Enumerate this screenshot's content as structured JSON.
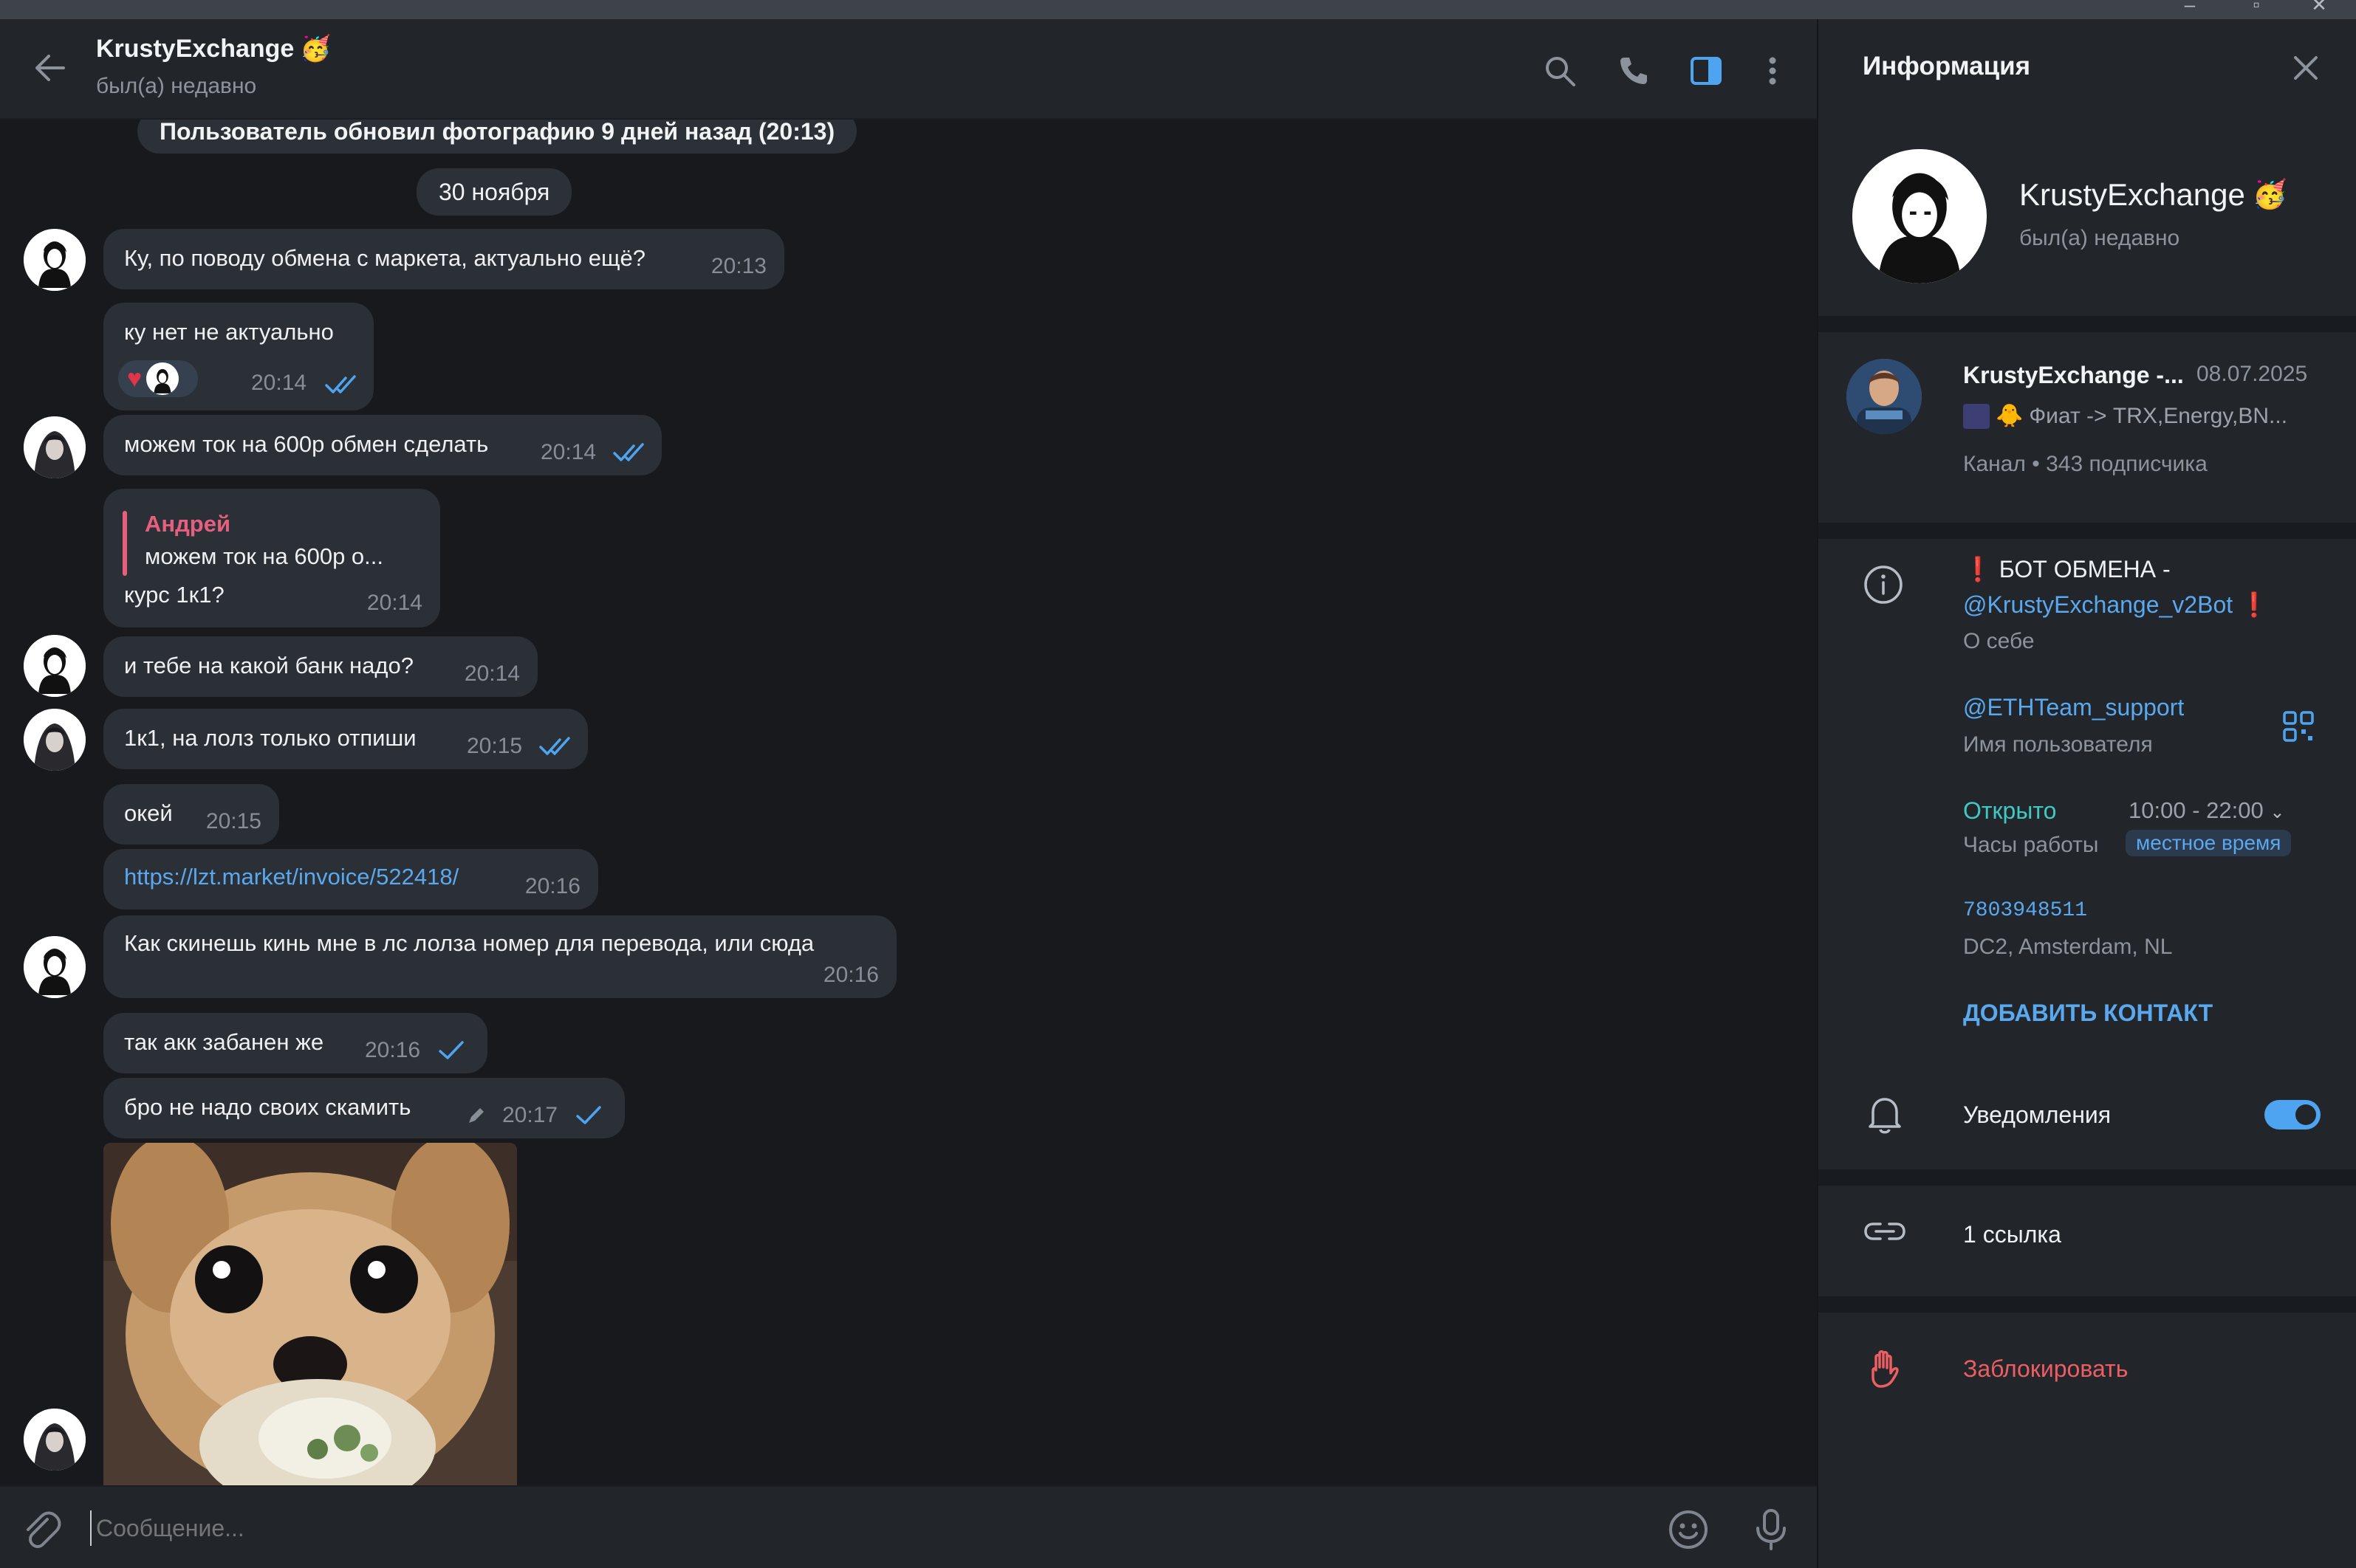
{
  "chat": {
    "title": "KrustyExchange",
    "status": "был(а) недавно",
    "service_photo": "Пользователь обновил фотографию 9 дней назад (20:13)",
    "date_label": "30 ноября",
    "messages": [
      {
        "text": "Ку, по поводу обмена с маркета, актуально ещё?",
        "time": "20:13"
      },
      {
        "text": "ку нет не актуально",
        "time": "20:14"
      },
      {
        "text": "можем ток на 600р обмен сделать",
        "time": "20:14"
      },
      {
        "reply_name": "Андрей",
        "reply_text": "можем ток на 600р о...",
        "text": "курс 1к1?",
        "time": "20:14"
      },
      {
        "text": "и тебе на какой банк надо?",
        "time": "20:14"
      },
      {
        "text": "1к1, на лолз только отпиши",
        "time": "20:15"
      },
      {
        "text": "окей",
        "time": "20:15"
      },
      {
        "text": "https://lzt.market/invoice/522418/",
        "time": "20:16"
      },
      {
        "text": "Как скинешь кинь мне в лс лолза номер для перевода, или сюда",
        "time": "20:16"
      },
      {
        "text": "так акк забанен же",
        "time": "20:16"
      },
      {
        "text": "бро не надо своих скамить",
        "time": "20:17"
      }
    ],
    "composer_placeholder": "Сообщение..."
  },
  "info": {
    "header": "Информация",
    "name": "KrustyExchange",
    "status": "был(а) недавно",
    "channel": {
      "name": "KrustyExchange -...",
      "date": "08.07.2025",
      "preview": "Фиат -> TRX,Energy,BN...",
      "meta": "Канал • 343 подписчика"
    },
    "bio_line1": "БОТ ОБМЕНА -",
    "bio_link": "@KrustyExchange_v2Bot",
    "bio_label": "О себе",
    "username": "@ETHTeam_support",
    "username_label": "Имя пользователя",
    "hours_status": "Открыто",
    "hours": "10:00 - 22:00",
    "hours_label": "Часы работы",
    "local_time": "местное время",
    "phone": "7803948511",
    "dc": "DC2, Amsterdam, NL",
    "add_contact": "ДОБАВИТЬ КОНТАКТ",
    "notifications": "Уведомления",
    "notifications_on": true,
    "links": "1 ссылка",
    "block": "Заблокировать"
  },
  "colors": {
    "accent": "#5aa8ee",
    "reply": "#e4607e",
    "online": "#3fc9c4",
    "danger": "#ec5e63",
    "reaction": "#e3344a"
  }
}
